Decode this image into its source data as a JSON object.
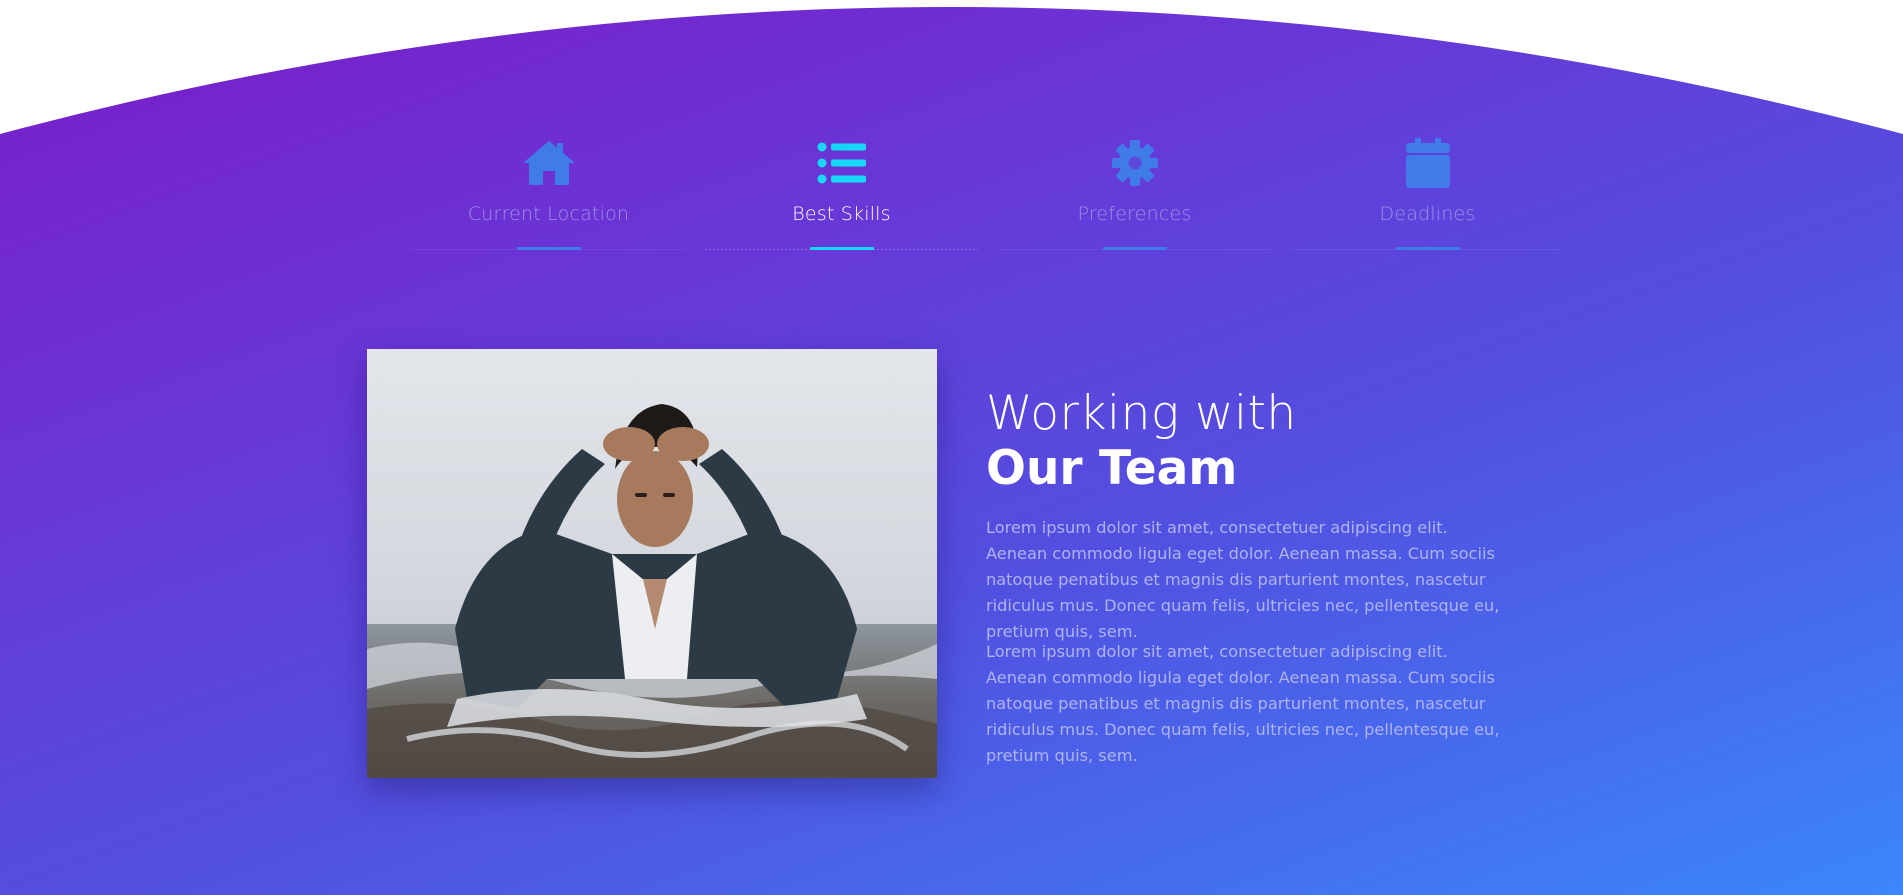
{
  "colors": {
    "gradient_start": "#7a1cc7",
    "gradient_end": "#3b86fb",
    "icon_inactive": "#3f7ce8",
    "icon_active": "#17d8f4",
    "label_inactive": "#9d90e8",
    "label_active": "#ffffff"
  },
  "tabs": [
    {
      "label": "Current Location",
      "icon": "home-icon",
      "active": false
    },
    {
      "label": "Best Skills",
      "icon": "list-icon",
      "active": true
    },
    {
      "label": "Preferences",
      "icon": "gear-icon",
      "active": false
    },
    {
      "label": "Deadlines",
      "icon": "calendar-icon",
      "active": false
    }
  ],
  "feature": {
    "image": "team-photo",
    "title_light": "Working with",
    "title_bold": "Our Team",
    "paragraphs": [
      "Lorem ipsum dolor sit amet, consectetuer adipiscing elit. Aenean commodo ligula eget dolor. Aenean massa. Cum sociis natoque penatibus et magnis dis parturient montes, nascetur ridiculus mus. Donec quam felis, ultricies nec, pellentesque eu, pretium quis, sem.",
      "Lorem ipsum dolor sit amet, consectetuer adipiscing elit. Aenean commodo ligula eget dolor. Aenean massa. Cum sociis natoque penatibus et magnis dis parturient montes, nascetur ridiculus mus. Donec quam felis, ultricies nec, pellentesque eu, pretium quis, sem."
    ]
  }
}
